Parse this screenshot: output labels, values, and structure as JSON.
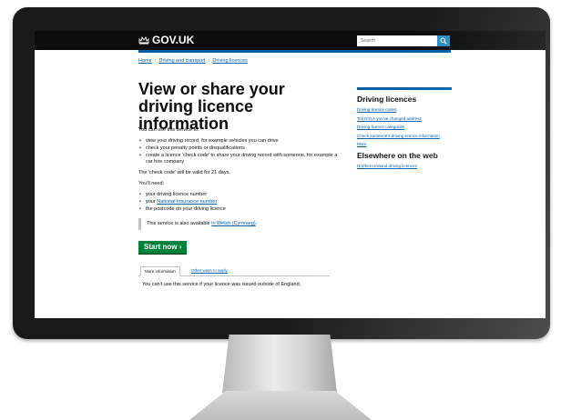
{
  "header": {
    "logo_text": "GOV.UK",
    "search_placeholder": "Search",
    "accent_color": "#005ea5"
  },
  "breadcrumb": [
    "Home",
    "Driving and transport",
    "Driving licences"
  ],
  "page": {
    "title": "View or share your driving licence information",
    "intro": "You can use this service to:",
    "uses": [
      "view your driving record, for example vehicles you can drive",
      "check your penalty points or disqualifications",
      "create a licence 'check code' to share your driving record with someone, for example a car hire company"
    ],
    "validity": "The 'check code' will be valid for 21 days.",
    "need_intro": "You'll need:",
    "needs": {
      "licence": "your driving licence number",
      "ni_prefix": "your ",
      "ni_link": "National Insurance number",
      "postcode": "the postcode on your driving licence"
    },
    "welsh_prefix": "This service is also available ",
    "welsh_link": "in Welsh (Cymraeg)",
    "welsh_suffix": ".",
    "start_label": "Start now",
    "start_icon": "chevron-right-icon",
    "start_color": "#00823b",
    "tabs": [
      "More information",
      "Other ways to apply"
    ],
    "tab_content": "You can't use this service if your licence was issued outside of England,"
  },
  "sidebar": {
    "heading": "Driving licences",
    "links": [
      "Driving licence codes",
      "Tell DVLA you've changed address",
      "Driving licence categories",
      "Check someone's driving licence information",
      "More"
    ],
    "web_heading": "Elsewhere on the web",
    "web_links": [
      "Northern Ireland driving licences"
    ]
  }
}
